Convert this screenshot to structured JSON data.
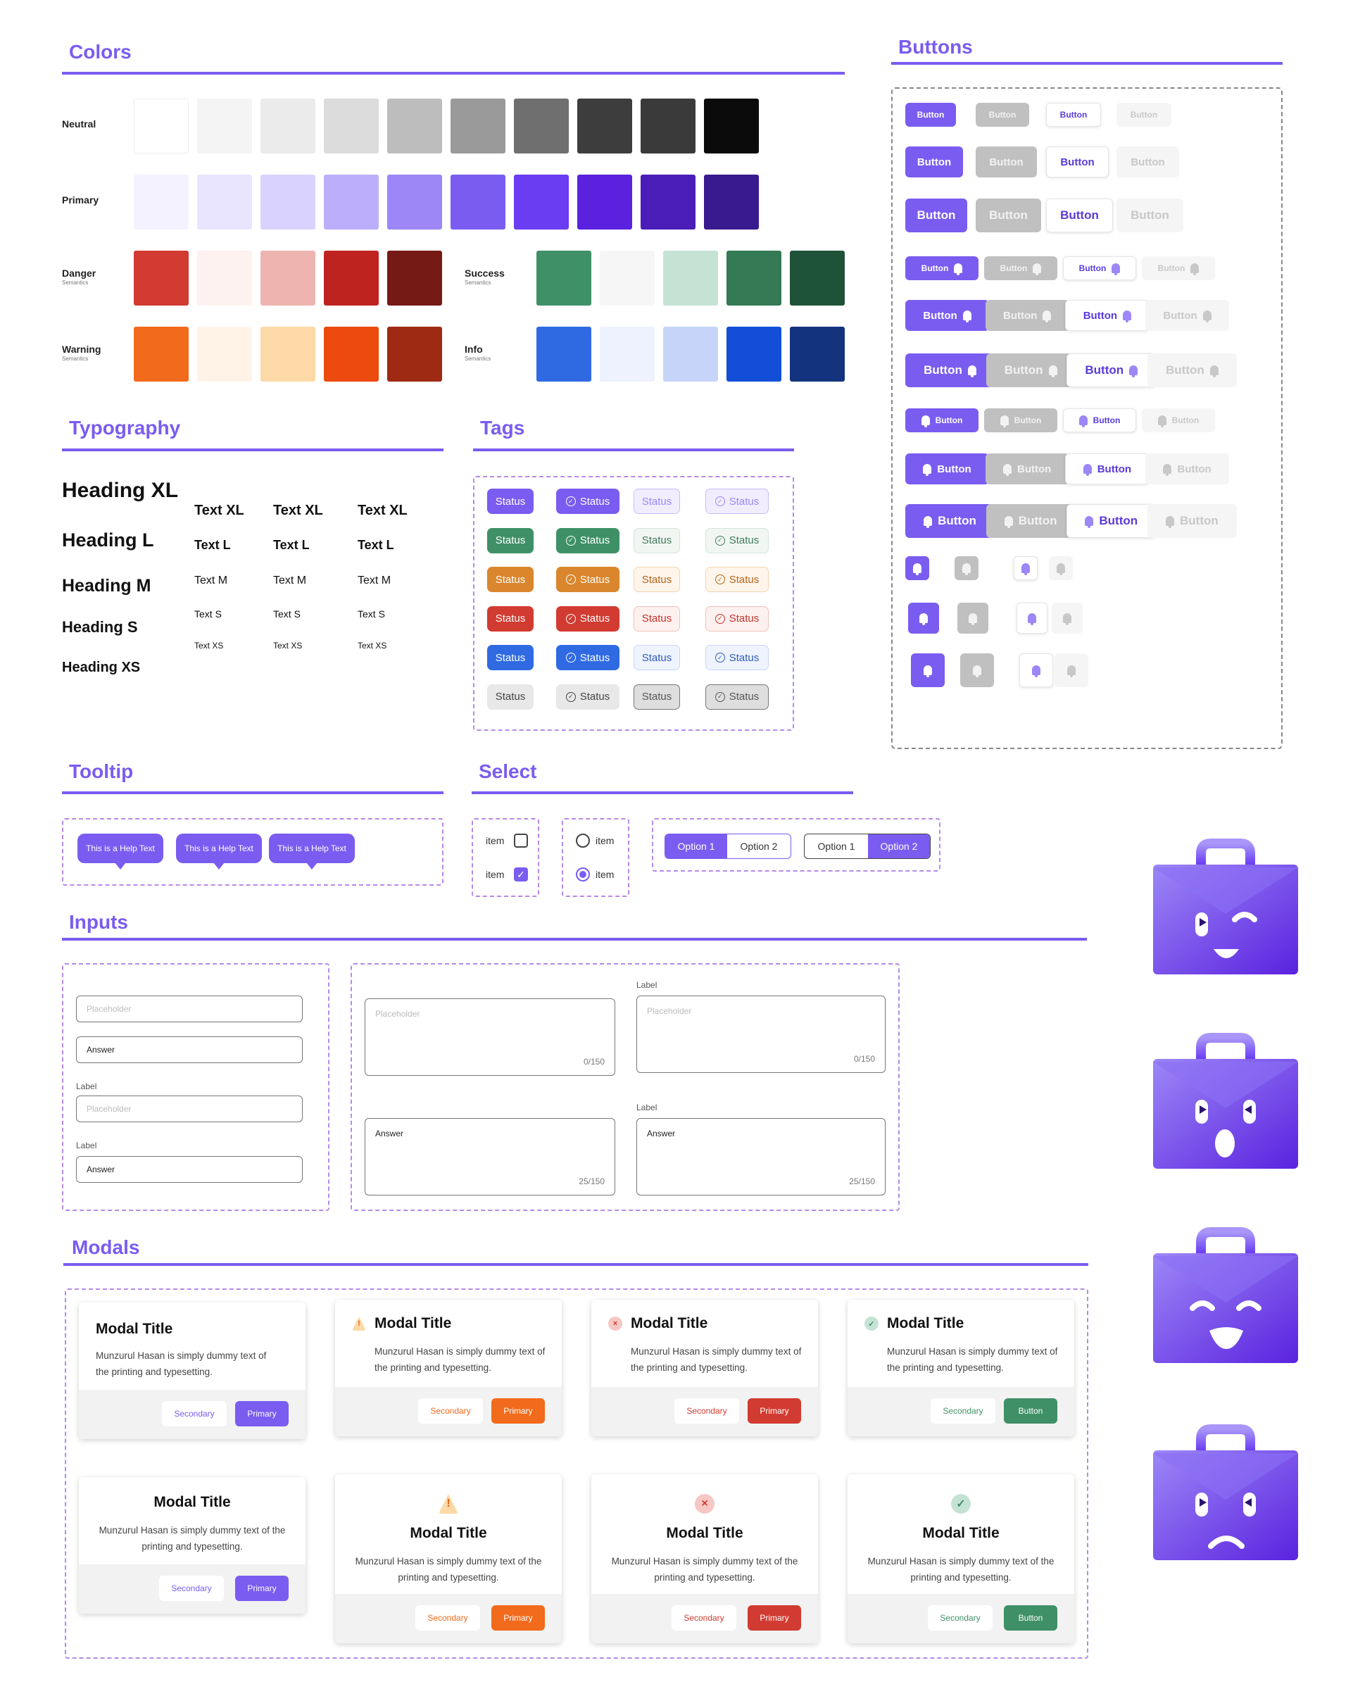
{
  "sections": {
    "colors": "Colors",
    "buttons": "Buttons",
    "typography": "Typography",
    "tags": "Tags",
    "tooltip": "Tooltip",
    "select": "Select",
    "inputs": "Inputs",
    "modals": "Modals"
  },
  "colors": {
    "neutral": {
      "label": "Neutral",
      "sub": "",
      "swatches": [
        "#ffffff",
        "#f4f4f4",
        "#ebebeb",
        "#dcdcdc",
        "#bdbdbd",
        "#9a9a9a",
        "#6f6f6f",
        "#3d3d3d",
        "#3a3a3a",
        "#0b0b0b"
      ]
    },
    "primary": {
      "label": "Primary",
      "sub": "",
      "swatches": [
        "#f4f2ff",
        "#e9e5ff",
        "#d9d2ff",
        "#bcaefb",
        "#9d87f7",
        "#7a5cf0",
        "#6a3cf2",
        "#5a22df",
        "#4a1db8",
        "#3a1a8f"
      ]
    },
    "danger": {
      "label": "Danger",
      "sub": "Semantics",
      "swatches": [
        "#d13b31",
        "#fdf2f0",
        "#eeb5b0",
        "#bf2320",
        "#761a16"
      ]
    },
    "success": {
      "label": "Success",
      "sub": "Semantics",
      "swatches": [
        "#3f9067",
        "#f5f6f5",
        "#c5e3d5",
        "#337a55",
        "#1f5339"
      ]
    },
    "warning": {
      "label": "Warning",
      "sub": "Semantics",
      "swatches": [
        "#f26a1b",
        "#fff3e8",
        "#fcd9a6",
        "#ec4a0f",
        "#9e2a14"
      ]
    },
    "info": {
      "label": "Info",
      "sub": "Semantics",
      "swatches": [
        "#2f6ae3",
        "#eef2ff",
        "#c5d4f8",
        "#124ed8",
        "#13337e"
      ]
    }
  },
  "typography": {
    "headings": [
      "Heading XL",
      "Heading L",
      "Heading M",
      "Heading S",
      "Heading XS"
    ],
    "texts": [
      "Text XL",
      "Text L",
      "Text M",
      "Text S",
      "Text XS"
    ]
  },
  "tags": {
    "label": "Status"
  },
  "buttons": {
    "label": "Button"
  },
  "tooltip": {
    "text": "This is a Help Text"
  },
  "select": {
    "item": "item",
    "option1": "Option 1",
    "option2": "Option 2"
  },
  "inputs": {
    "placeholder": "Placeholder",
    "answer": "Answer",
    "label": "Label",
    "count_empty": "0/150",
    "count_filled": "25/150"
  },
  "modals": {
    "title": "Modal Title",
    "body": "Munzurul Hasan is simply dummy text of the printing and typesetting.",
    "secondary": "Secondary",
    "primary": "Primary",
    "button": "Button",
    "accent_primary": "#7a5cf0",
    "accent_warning": "#f26a1b",
    "accent_danger": "#d13b31",
    "accent_success": "#3f9067"
  }
}
